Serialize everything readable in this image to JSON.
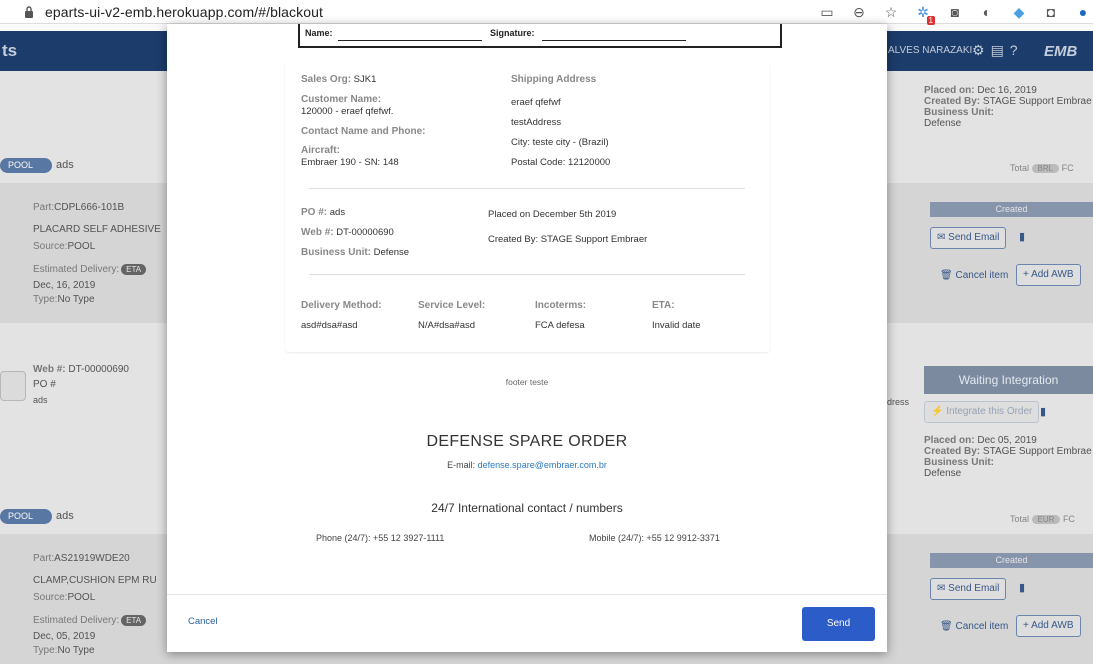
{
  "browser": {
    "url": "eparts-ui-v2-emb.herokuapp.com/#/blackout",
    "ext_badge": "1"
  },
  "app": {
    "title": "ts",
    "user": "ALVES NARAZAKI",
    "logo": "EMB"
  },
  "background": {
    "top_right": {
      "placed_on_label": "Placed on:",
      "placed_on_value": "Dec 16, 2019",
      "created_by_label": "Created By:",
      "created_by_value": "STAGE Support Embrae",
      "business_unit_label": "Business Unit:",
      "business_unit_value": "Defense"
    },
    "card1": {
      "pool": "POOL",
      "po": "ads",
      "total_label": "Total",
      "currency": "BRL",
      "fc": "FC",
      "part_label": "Part:",
      "part_value": "CDPL666-101B",
      "description": "PLACARD SELF ADHESIVE",
      "source_label": "Source:",
      "source_value": "POOL",
      "est_label": "Estimated Delivery:",
      "eta_badge": "ETA",
      "est_date": "Dec, 16, 2019",
      "type_label": "Type:",
      "type_value": "No Type",
      "status": "Created",
      "send_email": "Send Email",
      "cancel_item": "Cancel item",
      "add_awb": "+ Add AWB"
    },
    "order2": {
      "web_label": "Web #:",
      "web_value": "DT-00000690",
      "po_label": "PO #",
      "po_value": "ads",
      "address_partial": "dress",
      "status": "Waiting Integration",
      "integrate": "Integrate this Order",
      "placed_on_label": "Placed on:",
      "placed_on_value": "Dec 05, 2019",
      "created_by_label": "Created By:",
      "created_by_value": "STAGE Support Embrae",
      "business_unit_label": "Business Unit:",
      "business_unit_value": "Defense"
    },
    "card2": {
      "pool": "POOL",
      "po": "ads",
      "total_label": "Total",
      "currency": "EUR",
      "fc": "FC",
      "part_label": "Part:",
      "part_value": "AS21919WDE20",
      "description": "CLAMP,CUSHION EPM RU",
      "source_label": "Source:",
      "source_value": "POOL",
      "est_label": "Estimated Delivery:",
      "eta_badge": "ETA",
      "est_date": "Dec, 05, 2019",
      "type_label": "Type:",
      "type_value": "No Type",
      "status": "Created",
      "send_email": "Send Email",
      "cancel_item": "Cancel item",
      "add_awb": "+ Add AWB"
    }
  },
  "modal": {
    "signature_box": {
      "name_label": "Name:",
      "signature_label": "Signature:"
    },
    "document": {
      "sales_org_label": "Sales Org:",
      "sales_org_value": "SJK1",
      "customer_name_label": "Customer Name:",
      "customer_name_value": "120000 - eraef qfefwf.",
      "contact_label": "Contact Name and Phone:",
      "aircraft_label": "Aircraft:",
      "aircraft_value": "Embraer 190 - SN: 148",
      "shipping_label": "Shipping Address",
      "ship_line1": "eraef qfefwf",
      "ship_line2": "testAddress",
      "ship_line3": "City: teste city - (Brazil)",
      "ship_line4": "Postal Code: 12120000",
      "po_label": "PO #:",
      "po_value": "ads",
      "web_label": "Web #:",
      "web_value": "DT-00000690",
      "bu_label": "Business Unit:",
      "bu_value": "Defense",
      "placed_on": "Placed on December 5th 2019",
      "created_by": "Created By: STAGE Support Embraer",
      "delivery_method_label": "Delivery Method:",
      "delivery_method_value": "asd#dsa#asd",
      "service_level_label": "Service Level:",
      "service_level_value": "N/A#dsa#asd",
      "incoterms_label": "Incoterms:",
      "incoterms_value": "FCA defesa",
      "eta_label": "ETA:",
      "eta_value": "Invalid date"
    },
    "footer_text": "footer teste",
    "order_title": "DEFENSE SPARE ORDER",
    "email_label": "E-mail:",
    "email_value": "defense.spare@embraer.com.br",
    "contact_title": "24/7 International contact / numbers",
    "phone": "Phone (24/7): +55 12 3927-1111",
    "mobile": "Mobile (24/7): +55 12 9912-3371",
    "cancel": "Cancel",
    "send": "Send"
  }
}
